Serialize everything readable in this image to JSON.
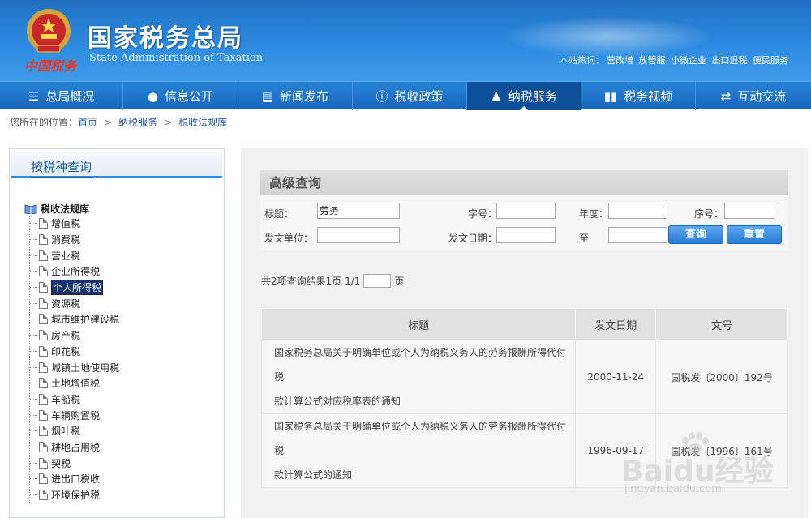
{
  "header": {
    "logo_script": "中国税务",
    "title_cn": "国家税务总局",
    "title_en": "State Administration of Taxation",
    "hot_label": "本站热词：",
    "hot_words": [
      "营改增",
      "放管服",
      "小微企业",
      "出口退税",
      "便民服务"
    ]
  },
  "nav": {
    "items": [
      {
        "label": "总局概况",
        "icon": "menu-icon"
      },
      {
        "label": "信息公开",
        "icon": "chat-icon"
      },
      {
        "label": "新闻发布",
        "icon": "news-icon"
      },
      {
        "label": "税收政策",
        "icon": "info-icon"
      },
      {
        "label": "纳税服务",
        "icon": "user-icon",
        "active": true
      },
      {
        "label": "税务视频",
        "icon": "video-icon"
      },
      {
        "label": "互动交流",
        "icon": "exchange-icon"
      }
    ]
  },
  "breadcrumb": {
    "prefix": "您所在的位置：",
    "items": [
      "首页",
      "纳税服务",
      "税收法规库"
    ],
    "sep": ">"
  },
  "sidebar": {
    "title": "按税种查询",
    "root": "税收法规库",
    "items": [
      "增值税",
      "消费税",
      "营业税",
      "企业所得税",
      "个人所得税",
      "资源税",
      "城市维护建设税",
      "房产税",
      "印花税",
      "城镇土地使用税",
      "土地增值税",
      "车船税",
      "车辆购置税",
      "烟叶税",
      "耕地占用税",
      "契税",
      "进出口税收",
      "环境保护税"
    ],
    "selected_index": 4
  },
  "search": {
    "title": "高级查询",
    "labels": {
      "title": "标题：",
      "zihao": "字号：",
      "niandu": "年度：",
      "xuhao": "序号：",
      "unit": "发文单位：",
      "date": "发文日期：",
      "to": "至"
    },
    "values": {
      "title": "劳务",
      "zihao": "",
      "niandu": "",
      "xuhao": "",
      "unit": "",
      "date_from": "",
      "date_to": ""
    },
    "query_button": "查询",
    "reset_button": "重置"
  },
  "result_info": {
    "text_before": "共2项查询结果1页 1/1",
    "page_value": "",
    "text_after": "页"
  },
  "table": {
    "headers": [
      "标题",
      "发文日期",
      "文号"
    ],
    "rows": [
      {
        "title_line1": "国家税务总局关于明确单位或个人为纳税义务人的劳务报酬所得代付税",
        "title_line2": "款计算公式对应税率表的通知",
        "date": "2000-11-24",
        "number": "国税发〔2000〕192号"
      },
      {
        "title_line1": "国家税务总局关于明确单位或个人为纳税义务人的劳务报酬所得代付税",
        "title_line2": "款计算公式的通知",
        "date": "1996-09-17",
        "number": "国税发〔1996〕161号"
      }
    ]
  },
  "watermark": {
    "brand": "Baidu经验",
    "url": "jingyan.baidu.com"
  }
}
